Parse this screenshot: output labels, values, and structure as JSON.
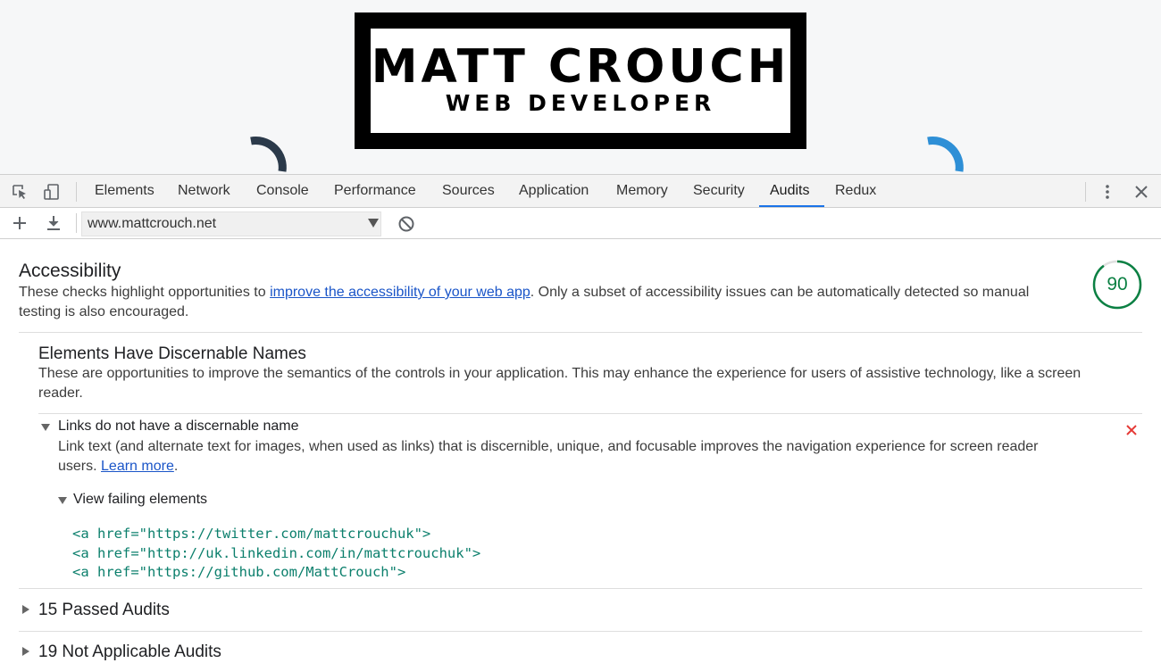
{
  "preview": {
    "logo_title": "MATT CROUCH",
    "logo_subtitle": "WEB DEVELOPER"
  },
  "devtools": {
    "tabs": [
      {
        "label": "Elements"
      },
      {
        "label": "Network"
      },
      {
        "label": "Console"
      },
      {
        "label": "Performance"
      },
      {
        "label": "Sources"
      },
      {
        "label": "Application"
      },
      {
        "label": "Memory"
      },
      {
        "label": "Security"
      },
      {
        "label": "Audits"
      },
      {
        "label": "Redux"
      }
    ],
    "active_tab": "Audits",
    "url": "www.mattcrouch.net"
  },
  "category": {
    "title": "Accessibility",
    "desc_before": "These checks highlight opportunities to ",
    "desc_link": "improve the accessibility of your web app",
    "desc_after": ". Only a subset of accessibility issues can be automatically detected so manual",
    "desc_line2": "testing is also encouraged.",
    "score": 90
  },
  "group": {
    "title": "Elements Have Discernable Names",
    "desc_line1": "These are opportunities to improve the semantics of the controls in your application. This may enhance the experience for users of assistive technology, like a screen",
    "desc_line2": "reader."
  },
  "audit": {
    "title": "Links do not have a discernable name",
    "desc_line1": "Link text (and alternate text for images, when used as links) that is discernible, unique, and focusable improves the navigation experience for screen reader",
    "desc_line2_before": "users. ",
    "learn_more": "Learn more",
    "desc_line2_after": ".",
    "failing_label": "View failing elements",
    "failing_elements": [
      "<a href=\"https://twitter.com/mattcrouchuk\">",
      "<a href=\"http://uk.linkedin.com/in/mattcrouchuk\">",
      "<a href=\"https://github.com/MattCrouch\">"
    ]
  },
  "passed": "15 Passed Audits",
  "not_applicable": "19 Not Applicable Audits",
  "colors": {
    "score_good": "#0b8043",
    "fail": "#e53935",
    "accent": "#1a73e8",
    "code": "#0b7f6c"
  }
}
